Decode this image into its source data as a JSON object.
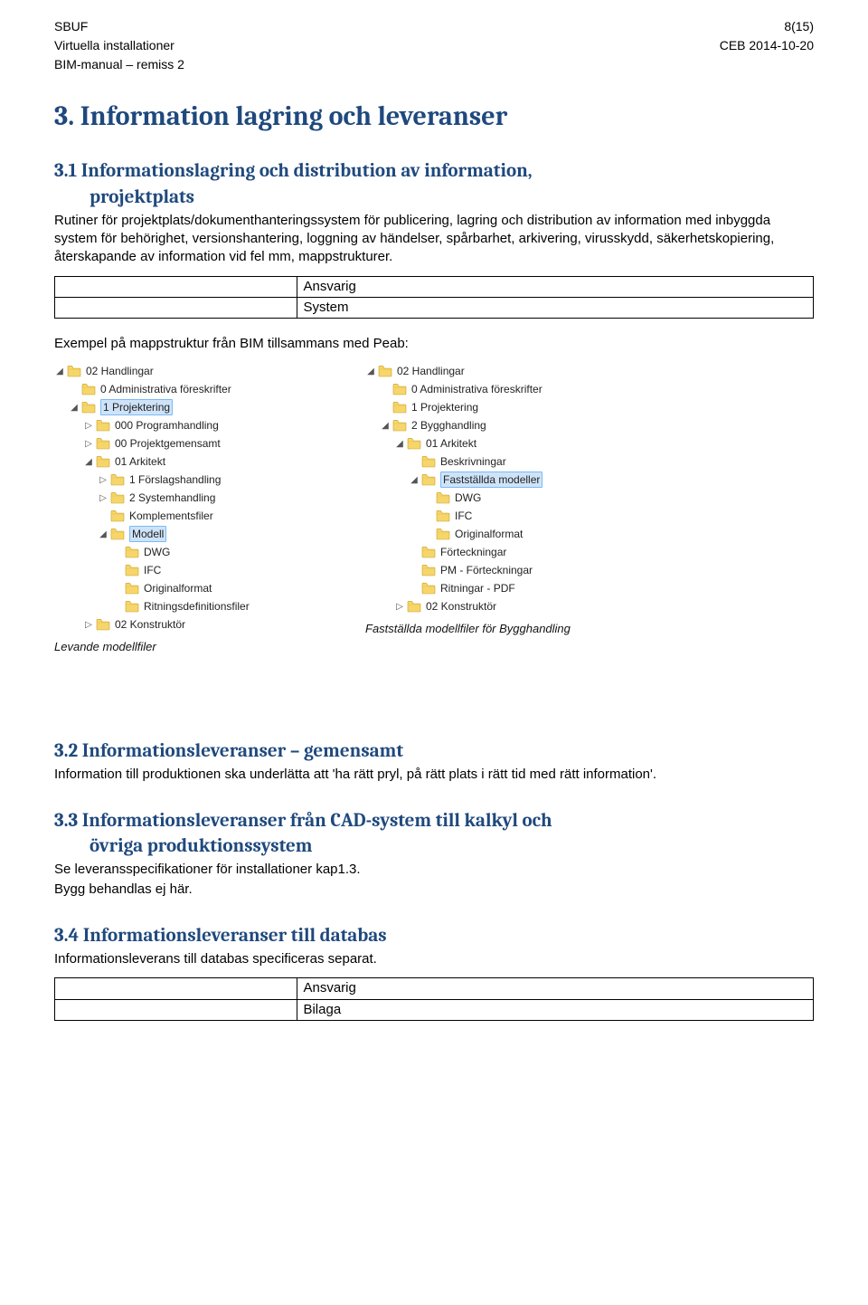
{
  "header": {
    "left1": "SBUF",
    "left2": "Virtuella installationer",
    "left3": "BIM-manual – remiss 2",
    "rightPage": "8(15)",
    "rightDate": "CEB 2014-10-20"
  },
  "h1": "3. Information lagring och leveranser",
  "sec31": {
    "heading": "3.1 Informationslagring och distribution av information, projektplats",
    "headingIndent": "projektplats",
    "headingMain": "3.1 Informationslagring och distribution av information,",
    "para": "Rutiner för projektplats/dokumenthanteringssystem för publicering, lagring och distribution av information med inbyggda system för behörighet, versionshantering, loggning av händelser, spårbarhet, arkivering, virusskydd, säkerhetskopiering, återskapande av information vid fel mm, mappstrukturer."
  },
  "table1": {
    "r1": "Ansvarig",
    "r2": "System"
  },
  "exampleLabel": "Exempel på mappstruktur från BIM tillsammans med Peab:",
  "treeLeft": {
    "items": [
      {
        "depth": 0,
        "exp": "◢",
        "label": "02 Handlingar",
        "sel": false
      },
      {
        "depth": 1,
        "exp": "",
        "label": "0 Administrativa föreskrifter",
        "sel": false
      },
      {
        "depth": 1,
        "exp": "◢",
        "label": "1 Projektering",
        "sel": true
      },
      {
        "depth": 2,
        "exp": "▷",
        "label": "000 Programhandling",
        "sel": false
      },
      {
        "depth": 2,
        "exp": "▷",
        "label": "00 Projektgemensamt",
        "sel": false
      },
      {
        "depth": 2,
        "exp": "◢",
        "label": "01 Arkitekt",
        "sel": false
      },
      {
        "depth": 3,
        "exp": "▷",
        "label": "1 Förslagshandling",
        "sel": false
      },
      {
        "depth": 3,
        "exp": "▷",
        "label": "2 Systemhandling",
        "sel": false
      },
      {
        "depth": 3,
        "exp": "",
        "label": "Komplementsfiler",
        "sel": false
      },
      {
        "depth": 3,
        "exp": "◢",
        "label": "Modell",
        "sel": true
      },
      {
        "depth": 4,
        "exp": "",
        "label": "DWG",
        "sel": false
      },
      {
        "depth": 4,
        "exp": "",
        "label": "IFC",
        "sel": false
      },
      {
        "depth": 4,
        "exp": "",
        "label": "Originalformat",
        "sel": false
      },
      {
        "depth": 4,
        "exp": "",
        "label": "Ritningsdefinitionsfiler",
        "sel": false
      },
      {
        "depth": 2,
        "exp": "▷",
        "label": "02 Konstruktör",
        "sel": false
      }
    ],
    "caption": "Levande modellfiler"
  },
  "treeRight": {
    "items": [
      {
        "depth": 0,
        "exp": "◢",
        "label": "02 Handlingar",
        "sel": false
      },
      {
        "depth": 1,
        "exp": "",
        "label": "0 Administrativa föreskrifter",
        "sel": false
      },
      {
        "depth": 1,
        "exp": "",
        "label": "1 Projektering",
        "sel": false
      },
      {
        "depth": 1,
        "exp": "◢",
        "label": "2 Bygghandling",
        "sel": false
      },
      {
        "depth": 2,
        "exp": "◢",
        "label": "01 Arkitekt",
        "sel": false
      },
      {
        "depth": 3,
        "exp": "",
        "label": "Beskrivningar",
        "sel": false
      },
      {
        "depth": 3,
        "exp": "◢",
        "label": "Fastställda modeller",
        "sel": true
      },
      {
        "depth": 4,
        "exp": "",
        "label": "DWG",
        "sel": false
      },
      {
        "depth": 4,
        "exp": "",
        "label": "IFC",
        "sel": false
      },
      {
        "depth": 4,
        "exp": "",
        "label": "Originalformat",
        "sel": false
      },
      {
        "depth": 3,
        "exp": "",
        "label": "Förteckningar",
        "sel": false
      },
      {
        "depth": 3,
        "exp": "",
        "label": "PM - Förteckningar",
        "sel": false
      },
      {
        "depth": 3,
        "exp": "",
        "label": "Ritningar - PDF",
        "sel": false
      },
      {
        "depth": 2,
        "exp": "▷",
        "label": "02 Konstruktör",
        "sel": false
      }
    ],
    "caption": "Fastställda modellfiler för Bygghandling"
  },
  "sec32": {
    "heading": "3.2 Informationsleveranser – gemensamt",
    "para": "Information till produktionen ska underlätta att 'ha rätt pryl, på rätt plats i rätt tid med rätt information'."
  },
  "sec33": {
    "headingLine1": "3.3 Informationsleveranser från CAD-system till kalkyl och",
    "headingLine2": "övriga produktionssystem",
    "para1": "Se leveransspecifikationer för installationer kap1.3.",
    "para2": "Bygg behandlas ej här."
  },
  "sec34": {
    "heading": "3.4 Informationsleveranser till databas",
    "para": "Informationsleverans till databas specificeras separat."
  },
  "table2": {
    "r1": "Ansvarig",
    "r2": "Bilaga"
  }
}
